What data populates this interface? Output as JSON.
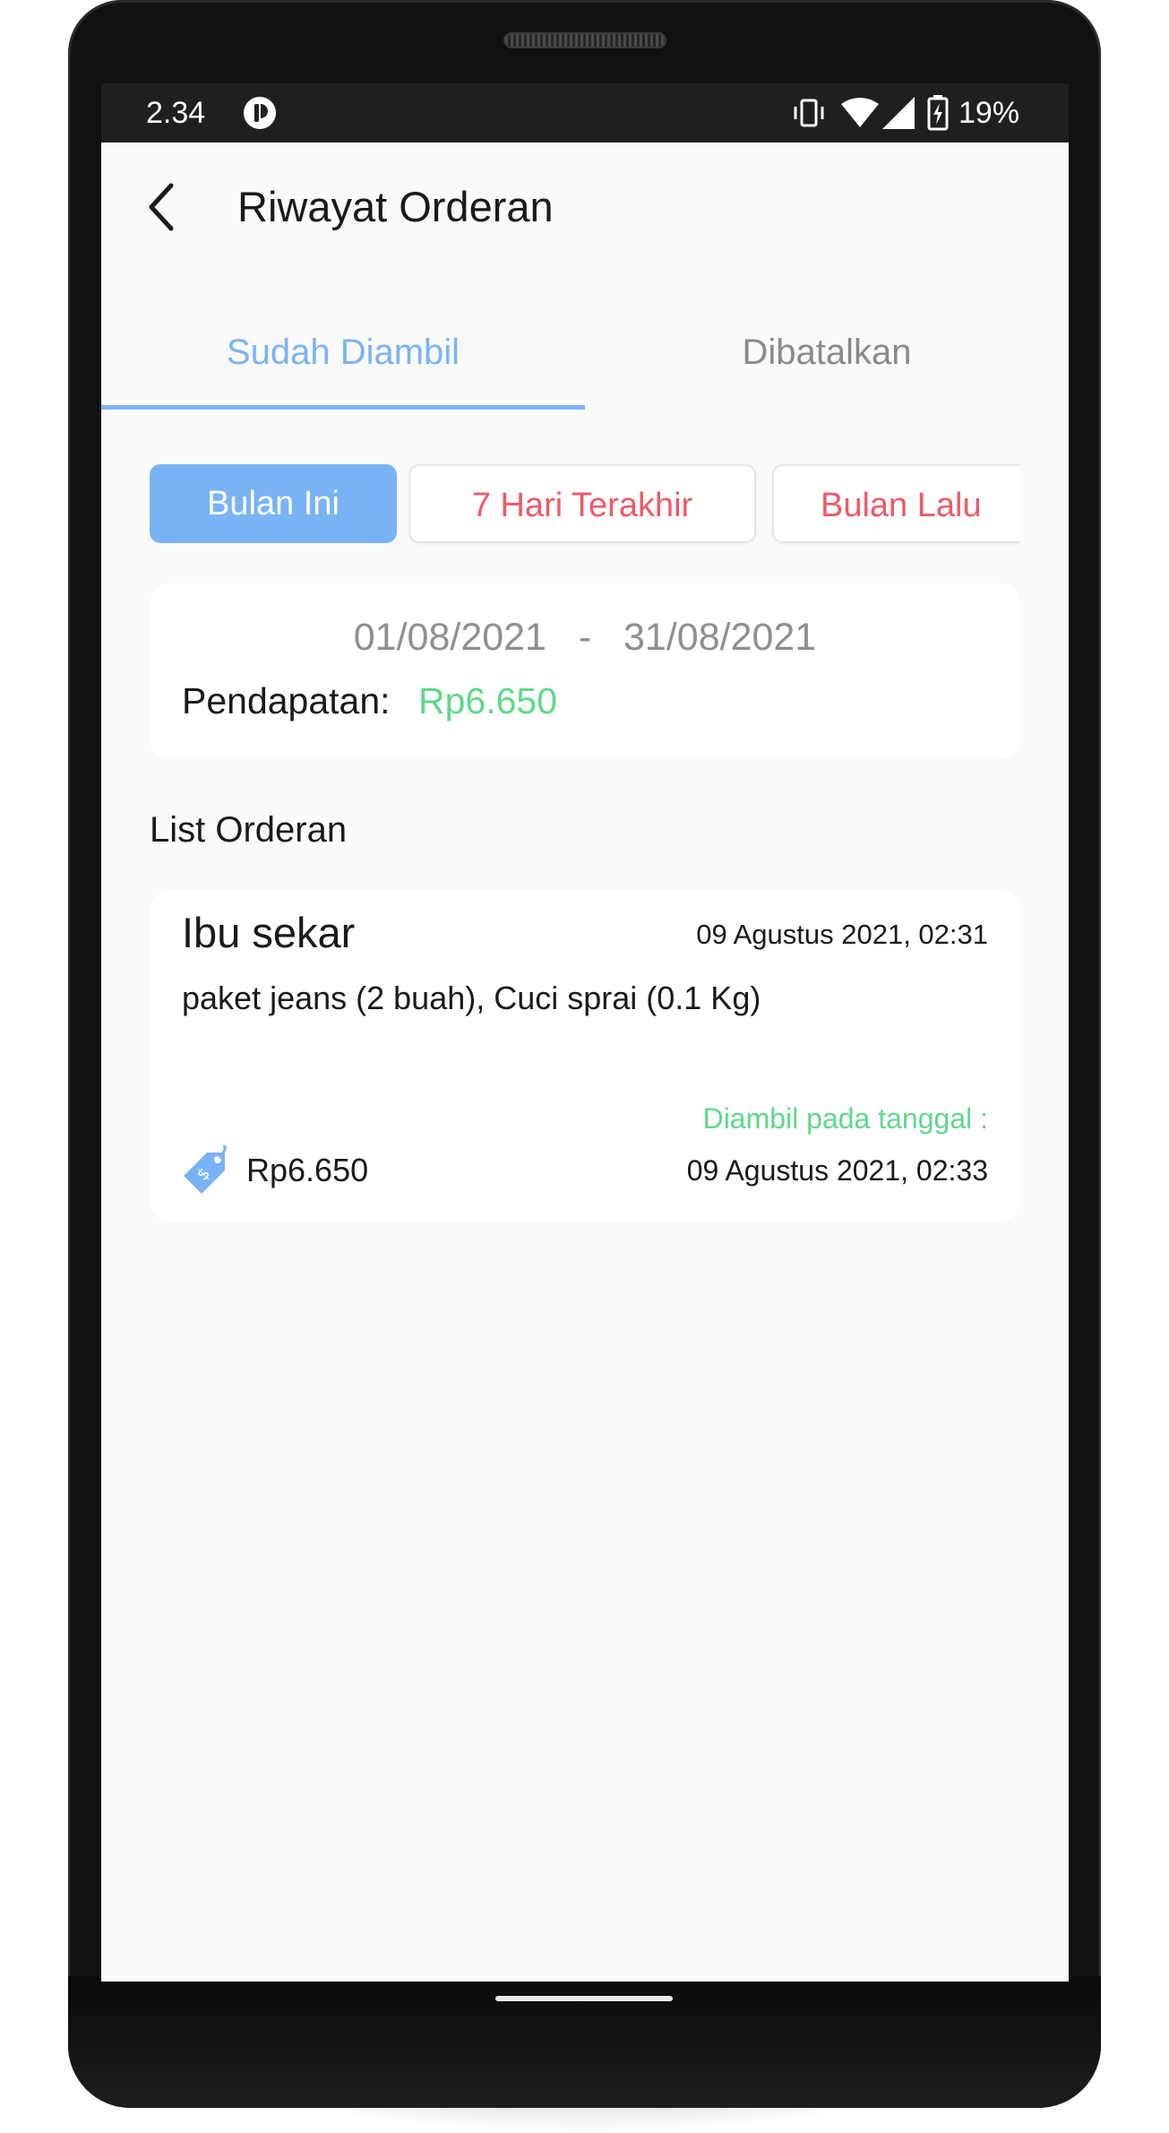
{
  "status_bar": {
    "time": "2.34",
    "battery": "19%",
    "app_icon": "circle-app-icon",
    "icons": [
      "vibrate-icon",
      "wifi-icon",
      "signal-icon",
      "battery-charging-icon"
    ]
  },
  "header": {
    "title": "Riwayat Orderan",
    "back_icon": "chevron-left-icon"
  },
  "tabs": [
    {
      "label": "Sudah Diambil",
      "active": true
    },
    {
      "label": "Dibatalkan",
      "active": false
    }
  ],
  "filters": [
    {
      "label": "Bulan Ini",
      "active": true
    },
    {
      "label": "7 Hari Terakhir",
      "active": false
    },
    {
      "label": "Bulan Lalu",
      "active": false
    }
  ],
  "summary": {
    "date_from": "01/08/2021",
    "separator": "-",
    "date_to": "31/08/2021",
    "income_label": "Pendapatan:",
    "income_value": "Rp6.650"
  },
  "list": {
    "heading": "List Orderan",
    "orders": [
      {
        "customer": "Ibu sekar",
        "date": "09 Agustus 2021, 02:31",
        "items": "paket jeans (2 buah), Cuci sprai (0.1 Kg)",
        "picked_label": "Diambil pada tanggal :",
        "picked_date": "09 Agustus 2021, 02:33",
        "price": "Rp6.650",
        "price_icon": "price-tag-icon"
      }
    ]
  },
  "colors": {
    "accent": "#7ab3f5",
    "danger": "#ee5a68",
    "success": "#5fd88a",
    "background": "#fafafa"
  }
}
